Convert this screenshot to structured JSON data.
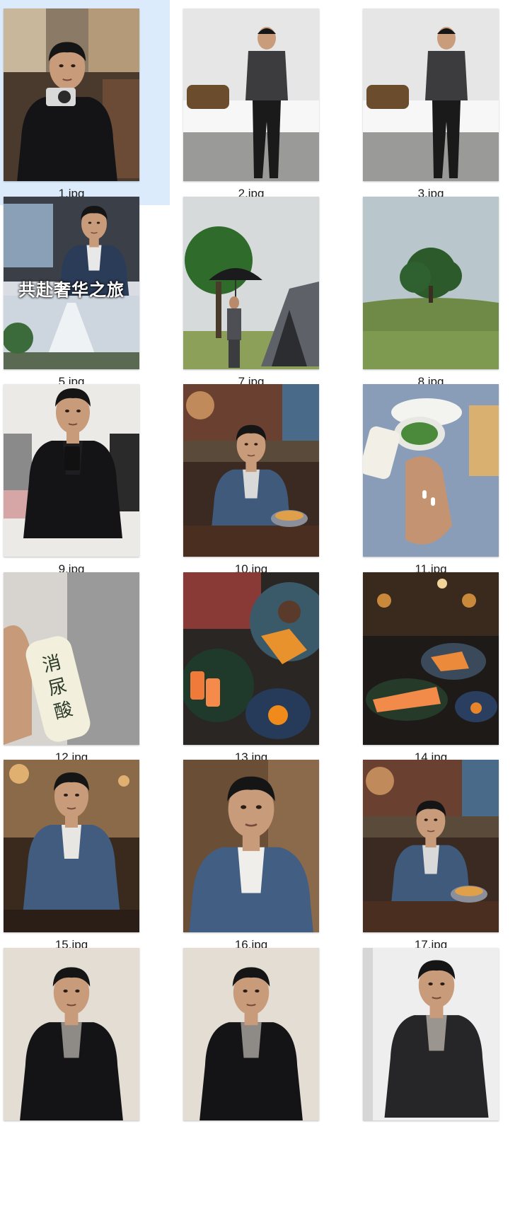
{
  "files": [
    {
      "name": "1.jpg",
      "selected": true,
      "scene": "cafe-camera"
    },
    {
      "name": "2.jpg",
      "scene": "bench-gray"
    },
    {
      "name": "3.jpg",
      "scene": "bench-gray"
    },
    {
      "name": "5.jpg",
      "scene": "car-poster",
      "overlay_text": "共赴奢华之旅"
    },
    {
      "name": "7.jpg",
      "scene": "umbrella-tent"
    },
    {
      "name": "8.jpg",
      "scene": "tree-field"
    },
    {
      "name": "9.jpg",
      "scene": "mirror-selfie"
    },
    {
      "name": "10.jpg",
      "scene": "dining-man"
    },
    {
      "name": "11.jpg",
      "scene": "pills-food"
    },
    {
      "name": "12.jpg",
      "scene": "bottle-hand",
      "overlay_text": "消尿酸"
    },
    {
      "name": "13.jpg",
      "scene": "food-closeup"
    },
    {
      "name": "14.jpg",
      "scene": "food-restaurant"
    },
    {
      "name": "15.jpg",
      "scene": "denim-restaurant"
    },
    {
      "name": "16.jpg",
      "scene": "denim-closeup"
    },
    {
      "name": "17.jpg",
      "scene": "dining-man"
    },
    {
      "name": "",
      "scene": "leather-jacket"
    },
    {
      "name": "",
      "scene": "leather-jacket"
    },
    {
      "name": "",
      "scene": "leather-jacket-gray"
    }
  ]
}
